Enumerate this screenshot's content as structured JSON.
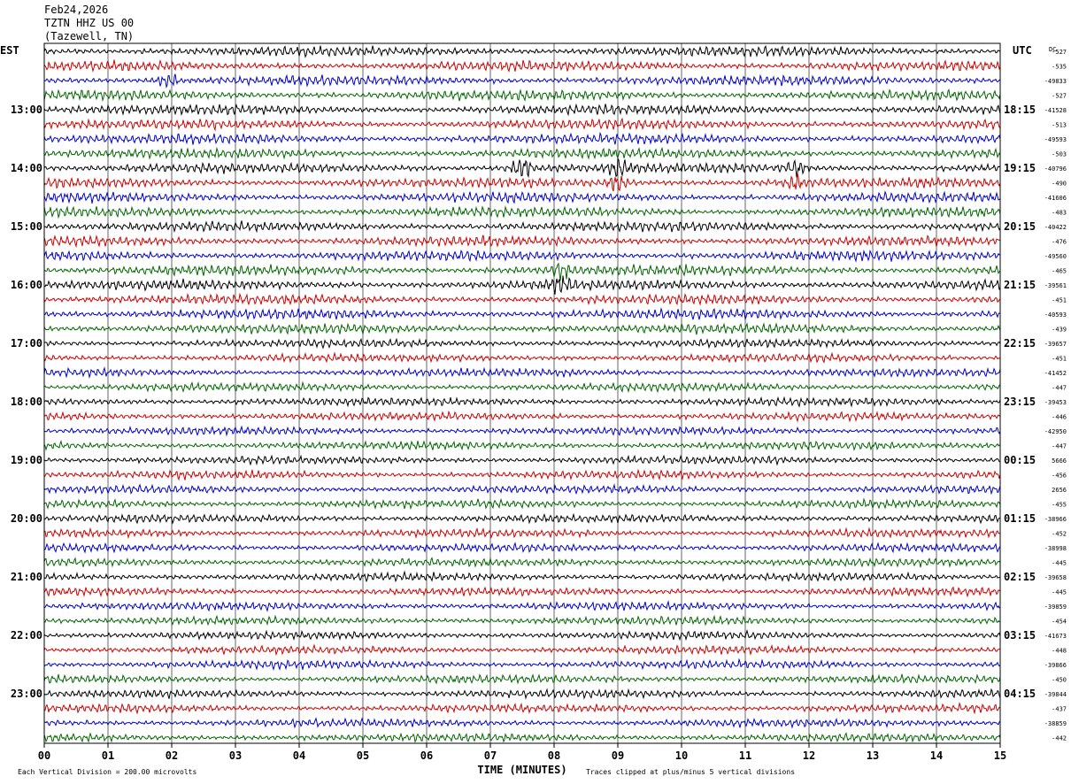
{
  "header": {
    "date": "Feb24,2026",
    "station": "TZTN HHZ US 00",
    "location": "(Tazewell, TN)"
  },
  "labels": {
    "left_zone": "EST",
    "right_zone": "UTC",
    "dc_header": "DC",
    "x_axis_title": "TIME (MINUTES)",
    "scale_note": "Each Vertical Division =  200.00 microvolts",
    "clip_note": "Traces clipped at plus/minus 5 vertical divisions"
  },
  "colors": {
    "trace_cycle": [
      "#000000",
      "#cc0000",
      "#0000cc",
      "#006600"
    ],
    "grid": "#000000",
    "background": "#ffffff"
  },
  "chart_data": {
    "type": "line",
    "description_kind": "helicorder",
    "x_ticks": [
      "00",
      "01",
      "02",
      "03",
      "04",
      "05",
      "06",
      "07",
      "08",
      "09",
      "10",
      "11",
      "12",
      "13",
      "14",
      "15"
    ],
    "xlim": [
      0,
      15
    ],
    "traces_per_hour": 4,
    "trace_count": 48,
    "left_hour_labels": [
      "13:00",
      "14:00",
      "15:00",
      "16:00",
      "17:00",
      "18:00",
      "19:00",
      "20:00",
      "21:00",
      "22:00",
      "23:00"
    ],
    "left_hour_label_trace_index": [
      4,
      8,
      12,
      16,
      20,
      24,
      28,
      32,
      36,
      40,
      44
    ],
    "right_hour_labels": [
      "18:15",
      "19:15",
      "20:15",
      "21:15",
      "22:15",
      "23:15",
      "00:15",
      "01:15",
      "02:15",
      "03:15",
      "04:15"
    ],
    "dc_offsets": [
      "-527",
      "-535",
      "-49833",
      "-527",
      "-41528",
      "-513",
      "-49593",
      "-503",
      "-40796",
      "-490",
      "-41606",
      "-483",
      "-40422",
      "-476",
      "-49560",
      "-465",
      "-39561",
      "-451",
      "-40593",
      "-439",
      "-39657",
      "-451",
      "-41452",
      "-447",
      "-39453",
      "-446",
      "-42950",
      "-447",
      "5666",
      "-456",
      "2656",
      "-455",
      "-38966",
      "-452",
      "-38998",
      "-445",
      "-39658",
      "-445",
      "-39859",
      "-454",
      "-41673",
      "-448",
      "-39866",
      "-450",
      "-39844",
      "-437",
      "-38859",
      "-442"
    ],
    "activity": {
      "bursts": [
        {
          "trace": 8,
          "minute": 7.5,
          "strength": 2.2
        },
        {
          "trace": 8,
          "minute": 9.0,
          "strength": 1.8
        },
        {
          "trace": 8,
          "minute": 11.8,
          "strength": 1.8
        },
        {
          "trace": 9,
          "minute": 9.0,
          "strength": 1.6
        },
        {
          "trace": 9,
          "minute": 11.8,
          "strength": 1.4
        },
        {
          "trace": 2,
          "minute": 1.95,
          "strength": 1.5
        },
        {
          "trace": 15,
          "minute": 8.1,
          "strength": 1.6
        },
        {
          "trace": 16,
          "minute": 8.1,
          "strength": 1.4
        }
      ]
    }
  }
}
